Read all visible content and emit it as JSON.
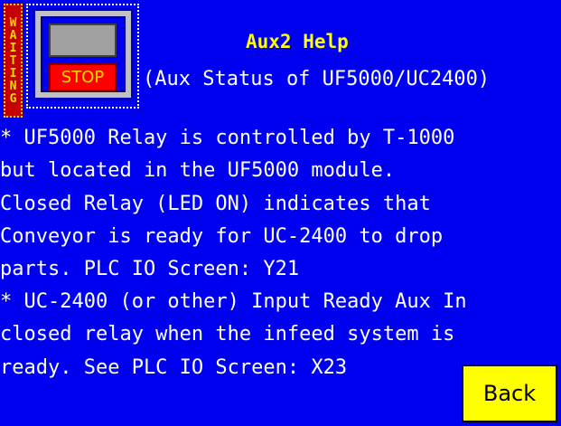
{
  "status": {
    "waiting_label": "WAITING",
    "stop_label": "STOP"
  },
  "header": {
    "title": "Aux2 Help",
    "subtitle": "(Aux Status of UF5000/UC2400)"
  },
  "help_lines": [
    "* UF5000 Relay is controlled by T-1000",
    "  but located in the UF5000 module.",
    " Closed Relay (LED ON) indicates that",
    " Conveyor is ready for UC-2400 to drop",
    " parts.  PLC IO Screen:  Y21",
    "* UC-2400 (or other) Input Ready Aux In",
    " closed relay when the infeed system is",
    " ready.  See PLC IO Screen: X23"
  ],
  "buttons": {
    "back_label": "Back"
  },
  "colors": {
    "background": "#0000f0",
    "title": "#ffff00",
    "text": "#ffffff",
    "stop": "#ff0000",
    "back": "#ffff00"
  }
}
